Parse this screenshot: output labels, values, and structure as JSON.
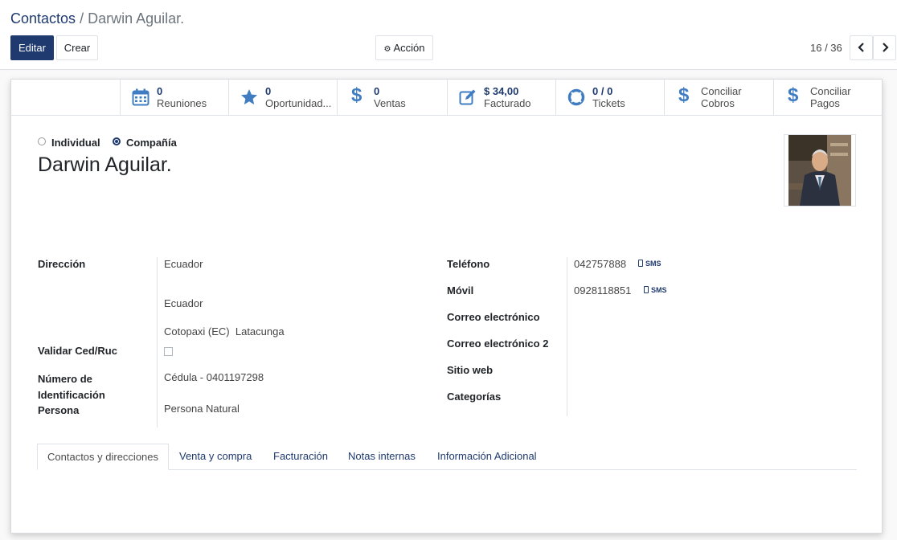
{
  "breadcrumb": {
    "parent": "Contactos",
    "separator": "/",
    "current": "Darwin Aguilar."
  },
  "toolbar": {
    "edit_label": "Editar",
    "create_label": "Crear",
    "action_label": "Acción",
    "action_icon": "gear-icon"
  },
  "pager": {
    "value": "16 / 36",
    "prev_icon": "chevron-left-icon",
    "next_icon": "chevron-right-icon"
  },
  "stat_buttons": [
    {
      "value": "0",
      "label": "Reuniones",
      "icon": "calendar-icon"
    },
    {
      "value": "0",
      "label": "Oportunidad...",
      "icon": "star-icon"
    },
    {
      "value": "0",
      "label": "Ventas",
      "icon": "dollar-icon"
    },
    {
      "value": "$ 34,00",
      "label": "Facturado",
      "icon": "edit-icon"
    },
    {
      "value": "0 / 0",
      "label": "Tickets",
      "icon": "lifebuoy-icon"
    },
    {
      "line1": "Conciliar",
      "line2": "Cobros",
      "icon": "dollar-icon"
    },
    {
      "line1": "Conciliar",
      "line2": "Pagos",
      "icon": "dollar-icon"
    }
  ],
  "company_type": {
    "options": [
      "Individual",
      "Compañía"
    ],
    "selected": "Compañía"
  },
  "partner": {
    "name": "Darwin Aguilar."
  },
  "left_fields": {
    "address_label": "Dirección",
    "address_line1": "Ecuador",
    "address_line2": "Ecuador",
    "address_line3": "Cotopaxi (EC)  Latacunga",
    "validate_label": "Validar Ced/Ruc",
    "validate_checked": false,
    "id_label_1": "Número de",
    "id_label_2": "Identificación",
    "id_label_3": "Persona",
    "id_value": "Cédula - 0401197298",
    "person_type": "Persona Natural"
  },
  "right_fields": {
    "phone_label": "Teléfono",
    "phone_value": "042757888",
    "mobile_label": "Móvil",
    "mobile_value": "0928118851",
    "sms_label": "SMS",
    "email_label": "Correo electrónico",
    "email2_label": "Correo electrónico 2",
    "website_label": "Sitio web",
    "categories_label": "Categorías"
  },
  "tabs": [
    {
      "label": "Contactos y direcciones",
      "active": true
    },
    {
      "label": "Venta y compra",
      "active": false
    },
    {
      "label": "Facturación",
      "active": false
    },
    {
      "label": "Notas internas",
      "active": false
    },
    {
      "label": "Información Adicional",
      "active": false
    }
  ],
  "colors": {
    "primary": "#1f3a6e",
    "stat_icon": "#3f7cc2",
    "text": "#212529"
  }
}
